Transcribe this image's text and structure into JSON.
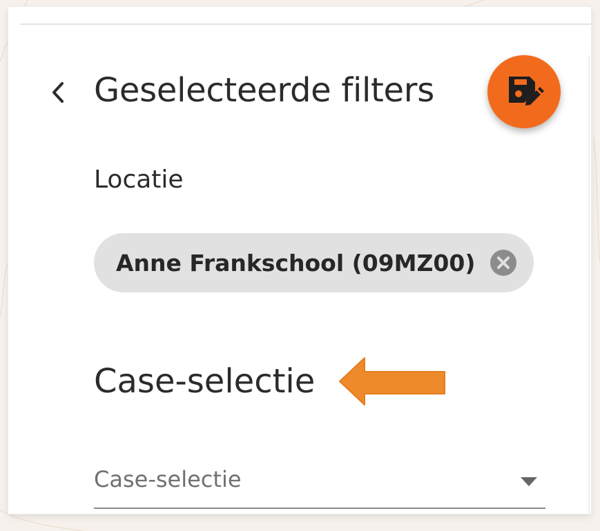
{
  "panel": {
    "title": "Geselecteerde filters",
    "back_icon": "chevron-left-icon",
    "save_icon": "save-edit-icon",
    "accent_color": "#f26b1d"
  },
  "location": {
    "label": "Locatie",
    "chip": {
      "label": "Anne Frankschool (09MZ00)",
      "remove_icon": "close-circle-icon"
    }
  },
  "case_selection": {
    "heading": "Case-selectie",
    "annotation_icon": "arrow-left-icon",
    "annotation_color": "#ee8a2b",
    "select": {
      "placeholder": "Case-selectie",
      "caret_icon": "caret-down-icon"
    }
  }
}
